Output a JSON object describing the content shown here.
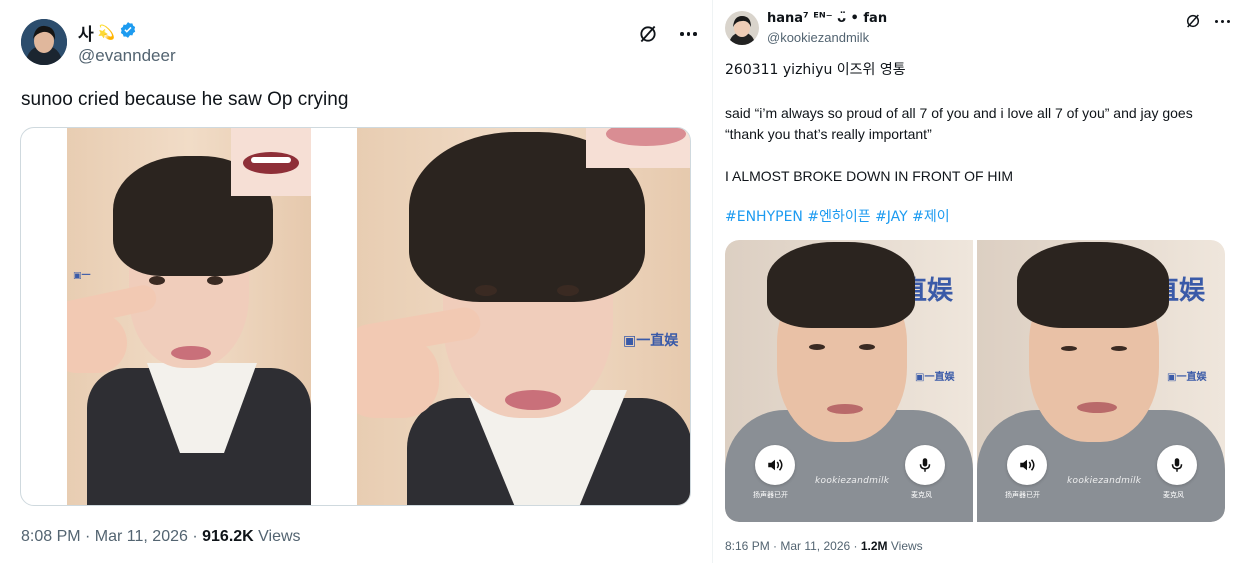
{
  "left_tweet": {
    "display_name": "사",
    "name_emoji": "💫",
    "handle": "@evanndeer",
    "text": "sunoo cried because he saw Op crying",
    "time": "8:08 PM · Mar 11, 2026 · ",
    "views_count": "916.2K",
    "views_label": " Views"
  },
  "right_tweet": {
    "display_name": "hana⁷ ᴱᴺ⁻ ᴗ̈ • fan",
    "handle": "@kookiezandmilk",
    "line1": "260311 yizhiyu 이즈위 영통",
    "line2": "said “i’m always so proud of all 7 of you and i love all 7 of you” and jay goes “thank you that’s really important”",
    "line3": "I ALMOST BROKE DOWN IN FRONT OF HIM",
    "hashtags": [
      "#ENHYPEN",
      "#엔하이픈",
      "#JAY",
      "#제이"
    ],
    "image_watermark": "kookiezandmilk",
    "image_captions": [
      "扬声器已开",
      "麦克风"
    ],
    "time": "8:16 PM · Mar 11, 2026 · ",
    "views_count": "1.2M",
    "views_label": " Views"
  },
  "colors": {
    "verified": "#1d9bf0",
    "link": "#1d9bf0",
    "muted": "#536471"
  },
  "icons": [
    "grok-icon",
    "more-icon",
    "verified-badge-icon",
    "speaker-icon",
    "mic-icon"
  ]
}
